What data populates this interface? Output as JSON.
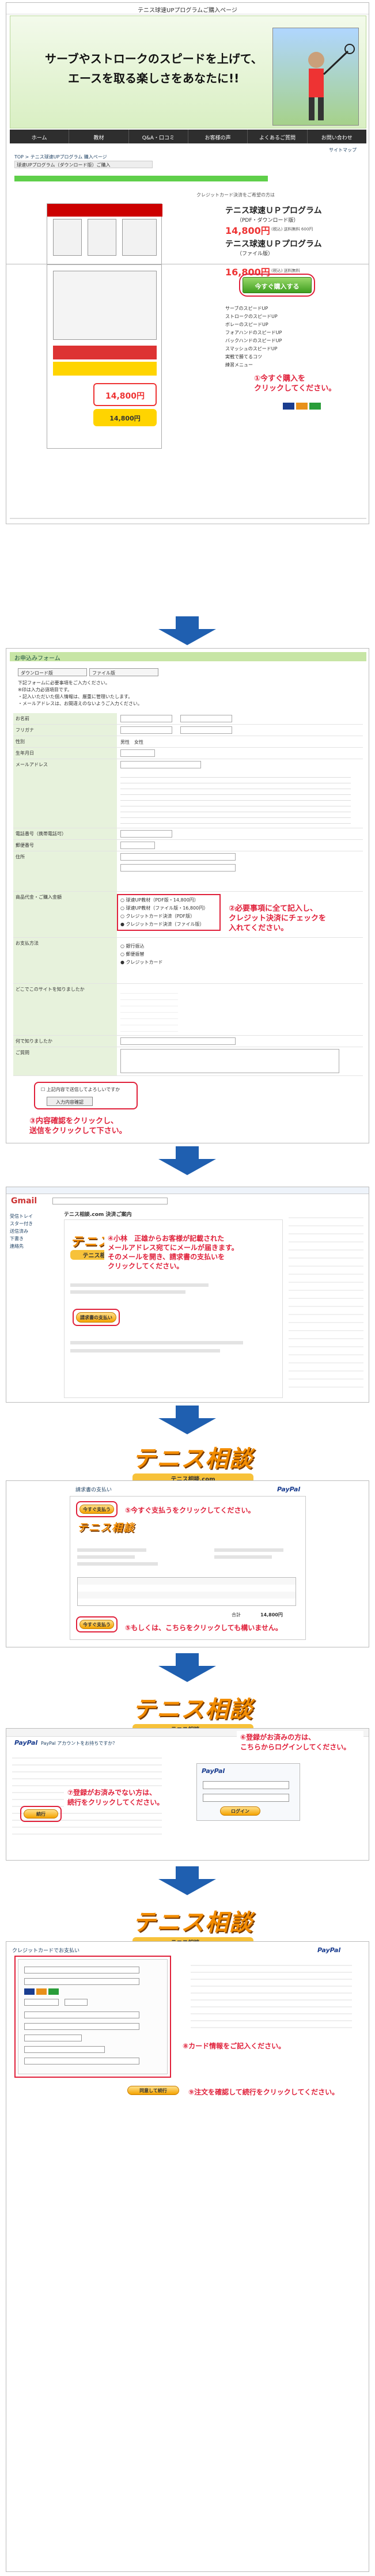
{
  "page": {
    "title": "テニス球速UPプログラムご購入ページ"
  },
  "s1": {
    "hero_line1": "サーブやストロークのスピードを上げて、",
    "hero_line2": "エースを取る楽しさをあなたに!!",
    "nav": [
      "ホーム",
      "教材",
      "Q&A・口コミ",
      "お客様の声",
      "よくあるご質問",
      "お問い合わせ"
    ],
    "sitemap": "サイトマップ",
    "breadcrumb": "TOP > テニス球速UPプログラム 購入ページ",
    "tab": "球速UPプログラム（ダウンロード版）ご購入",
    "note": "クレジットカード決済をご希望の方は",
    "prod1_title": "テニス球速ＵＰプログラム",
    "prod1_sub": "（PDF・ダウンロード版）",
    "prod1_price": "14,800円",
    "prod1_price_note": "(税込) 送料無料 600円",
    "prod2_title": "テニス球速ＵＰプログラム",
    "prod2_sub": "（ファイル版）",
    "prod2_price": "16,800円",
    "prod2_price_note": "(税込) 送料無料",
    "buy_btn": "今すぐ購入する",
    "callout": "①今すぐ購入を\nクリックしてください。",
    "price_badge": "14,800円",
    "price_badge2": "14,800円",
    "list": [
      "サーブのスピードUP",
      "ストロークのスピードUP",
      "ボレーのスピードUP",
      "フォアハンドのスピードUP",
      "バックハンドのスピードUP",
      "スマッシュのスピードUP",
      "実戦で勝てるコツ",
      "練習メニュー"
    ]
  },
  "s2": {
    "head": "お申込みフォーム",
    "tab1": "ダウンロード版",
    "tab2": "ファイル版",
    "intro1": "下記フォームに必要事項をご入力ください。",
    "intro2": "※印は入力必須項目です。",
    "intro3": "・記入いただいた個人情報は、厳重に管理いたします。",
    "intro4": "・メールアドレスは、お間違えのないようご入力ください。",
    "labels": [
      "お名前",
      "フリガナ",
      "性別",
      "生年月日",
      "メールアドレス",
      "",
      "",
      "",
      "",
      "",
      "電話番号（携帯電話可）",
      "郵便番号",
      "住所",
      "",
      "",
      "",
      "商品代金・ご購入金額",
      "",
      "",
      "",
      "お支払方法",
      "",
      "",
      "",
      "どこでこのサイトを知りましたか",
      "",
      "",
      "",
      "",
      "",
      "何で知りましたか",
      "ご質問"
    ],
    "gender": "男性　女性",
    "product_options": [
      "球速UP教材（PDF版・14,800円）",
      "球速UP教材（ファイル版・16,800円）",
      "クレジットカード決済（PDF版）",
      "クレジットカード決済（ファイル版）"
    ],
    "pay_options": [
      "銀行振込",
      "郵便振替",
      "クレジットカード"
    ],
    "callout": "②必要事項に全て記入し、\nクレジット決済にチェックを\n入れてください。",
    "agree": "上記内容で送信してよろしいですか",
    "confirm_btn": "入力内容確認",
    "bottom_callout": "③内容確認をクリックし、\n送信をクリックして下さい。"
  },
  "s3": {
    "app": "Gmail",
    "subject": "テニス相談.com 決済ご案内",
    "logo": "テニス相談",
    "logo_sub": "テニス相談.com",
    "callout": "④小林　正雄からお客様が記載された\nメールアドレス宛てにメールが届きます。\nそのメールを開き、請求書の支払いを\nクリックしてください。",
    "pay_btn": "請求書の支払い",
    "sidebar": [
      "受信トレイ",
      "スター付き",
      "送信済み",
      "下書き",
      "連絡先"
    ]
  },
  "s4": {
    "logo": "テニス相談",
    "logo_sub": "テニス相談.com",
    "paypal": "PayPal",
    "invoice_title": "請求書の支払い",
    "pay_now": "今すぐ支払う",
    "callout5a": "⑤今すぐ支払うをクリックしてください。",
    "callout5b": "⑤もしくは、こちらをクリックしても構いません。",
    "total_label": "合計",
    "total": "14,800円"
  },
  "s5": {
    "logo": "テニス相談",
    "logo_sub": "テニス相談.com",
    "paypal": "PayPal",
    "header": "PayPal アカウントをお持ちですか？",
    "login_btn": "ログイン",
    "callout6": "⑥登録がお済みの方は、\nこちらからログインしてください。",
    "callout7": "⑦登録がお済みでない方は、\n続行をクリックしてください。",
    "continue": "続行",
    "login": "ログイン"
  },
  "s6": {
    "logo": "テニス相談",
    "logo_sub": "テニス相談.com",
    "paypal": "PayPal",
    "header": "クレジットカードでお支払い",
    "callout8": "⑧カード情報をご記入ください。",
    "callout9": "⑨注文を確認して続行をクリックしてください。",
    "continue": "同意して続行"
  },
  "colors": {
    "accent_red": "#e0203a",
    "arrow_blue": "#1f5fb0",
    "form_green": "#c7e5a5",
    "logo_orange": "#f28c00"
  }
}
